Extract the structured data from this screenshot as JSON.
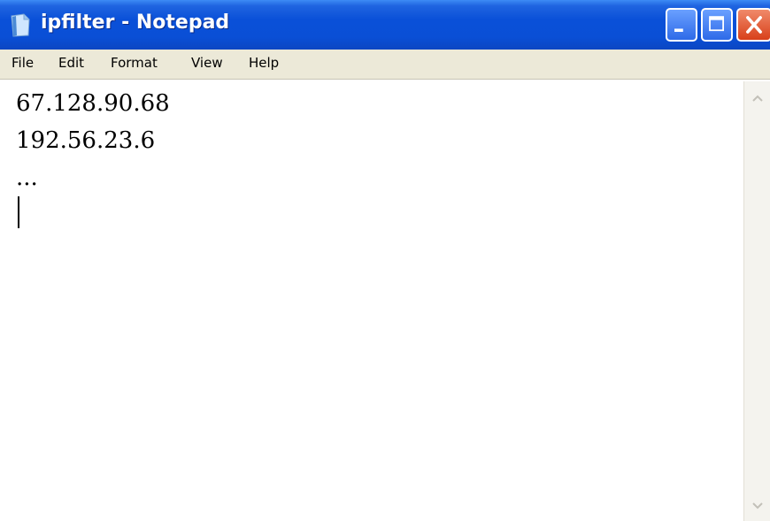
{
  "window": {
    "title": "ipfilter - Notepad"
  },
  "menu": {
    "file": "File",
    "edit": "Edit",
    "format": "Format",
    "view": "View",
    "help": "Help"
  },
  "editor": {
    "lines": [
      "67.128.90.68",
      "192.56.23.6",
      "..."
    ]
  },
  "icons": {
    "app": "notepad-icon",
    "minimize": "minimize-icon",
    "maximize": "maximize-icon",
    "close": "close-icon",
    "scroll_up": "scroll-up-icon",
    "scroll_down": "scroll-down-icon"
  },
  "colors": {
    "titlebar": "#0a50d8",
    "close_button": "#d8401a",
    "menubar": "#ece9d8"
  }
}
